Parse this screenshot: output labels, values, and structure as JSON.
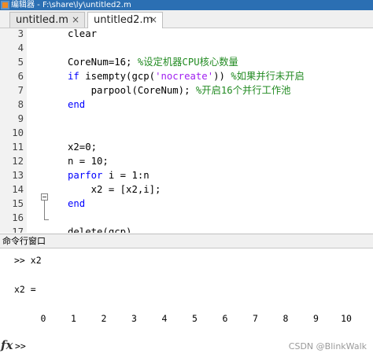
{
  "window": {
    "title": "编辑器 - F:\\share\\ly\\untitled2.m"
  },
  "tabs": [
    {
      "label": "untitled.m",
      "close": "×",
      "active": false
    },
    {
      "label": "untitled2.m",
      "close": "×",
      "active": true
    }
  ],
  "editor": {
    "lines": [
      {
        "num": "3",
        "indent": "",
        "parts": [
          {
            "t": "clear",
            "c": ""
          }
        ]
      },
      {
        "num": "4",
        "indent": "",
        "parts": []
      },
      {
        "num": "5",
        "indent": "",
        "parts": [
          {
            "t": "CoreNum=16; ",
            "c": ""
          },
          {
            "t": "%设定机器CPU核心数量",
            "c": "cmt"
          }
        ]
      },
      {
        "num": "6",
        "indent": "",
        "parts": [
          {
            "t": "if",
            "c": "kw"
          },
          {
            "t": " isempty(gcp(",
            "c": ""
          },
          {
            "t": "'nocreate'",
            "c": "str"
          },
          {
            "t": ")) ",
            "c": ""
          },
          {
            "t": "%如果并行未开启",
            "c": "cmt"
          }
        ]
      },
      {
        "num": "7",
        "indent": "    ",
        "parts": [
          {
            "t": "parpool(CoreNum); ",
            "c": ""
          },
          {
            "t": "%开启16个并行工作池",
            "c": "cmt"
          }
        ]
      },
      {
        "num": "8",
        "indent": "",
        "parts": [
          {
            "t": "end",
            "c": "kw"
          }
        ]
      },
      {
        "num": "9",
        "indent": "",
        "parts": []
      },
      {
        "num": "10",
        "indent": "",
        "parts": []
      },
      {
        "num": "11",
        "indent": "",
        "parts": [
          {
            "t": "x2=0;",
            "c": ""
          }
        ]
      },
      {
        "num": "12",
        "indent": "",
        "parts": [
          {
            "t": "n = 10;",
            "c": ""
          }
        ]
      },
      {
        "num": "13",
        "indent": "",
        "parts": [
          {
            "t": "parfor",
            "c": "kw"
          },
          {
            "t": " i = 1:n",
            "c": ""
          }
        ]
      },
      {
        "num": "14",
        "indent": "    ",
        "parts": [
          {
            "t": "x2 = [x2,i];",
            "c": ""
          }
        ]
      },
      {
        "num": "15",
        "indent": "",
        "parts": [
          {
            "t": "end",
            "c": "kw"
          }
        ]
      },
      {
        "num": "16",
        "indent": "",
        "parts": []
      },
      {
        "num": "17",
        "indent": "",
        "parts": [
          {
            "t": "delete(gcp)",
            "c": ""
          }
        ]
      }
    ]
  },
  "command_window": {
    "title": "命令行窗口",
    "entered_command": ">> x2",
    "output_label": "x2 =",
    "output_values": [
      "0",
      "1",
      "2",
      "3",
      "4",
      "5",
      "6",
      "7",
      "8",
      "9",
      "10"
    ],
    "fx": "fx",
    "prompt": ">>"
  },
  "watermark": "CSDN @BlinkWalk",
  "colors": {
    "keyword": "#0000ff",
    "string": "#a020f0",
    "comment": "#228b22",
    "titlebar": "#2b6fb3"
  }
}
